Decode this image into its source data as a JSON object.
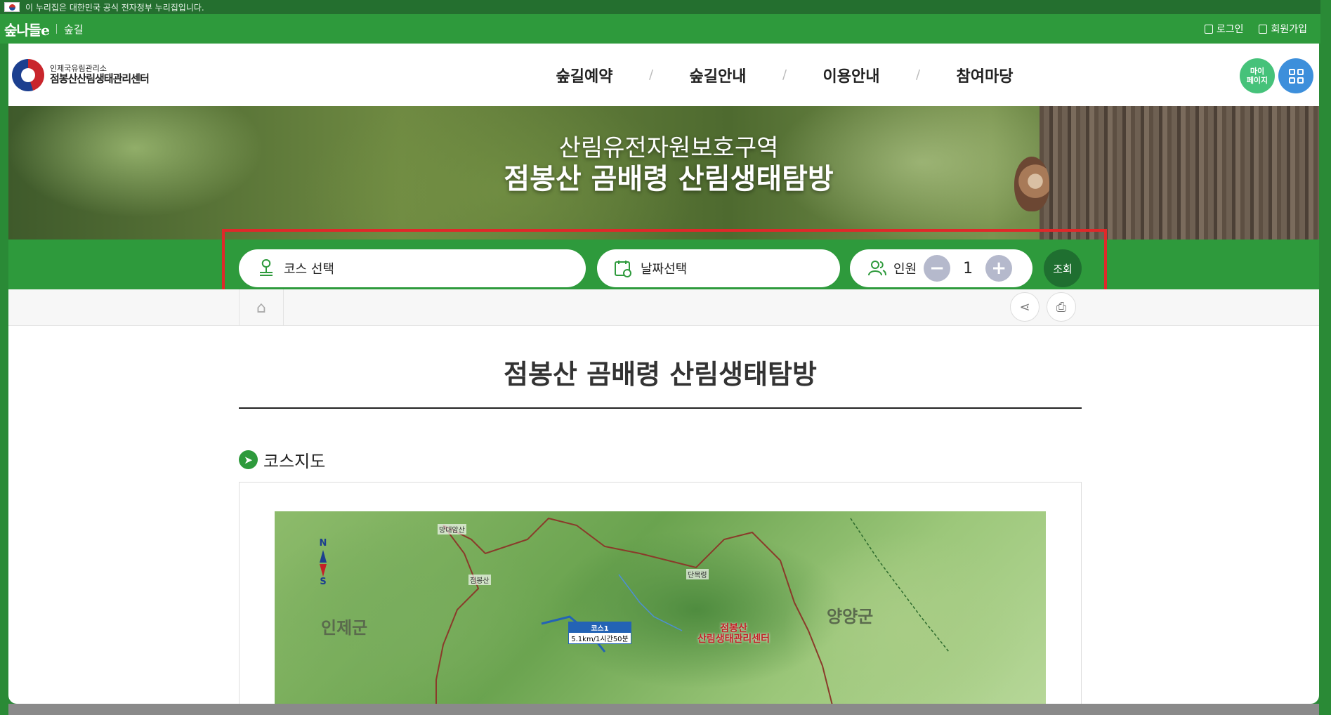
{
  "gov_banner": {
    "text": "이 누리집은 대한민국 공식 전자정부 누리집입니다."
  },
  "topbar": {
    "brand_logo": "숲나들e",
    "brand_sub": "숲길",
    "login": "로그인",
    "signup": "회원가입"
  },
  "header": {
    "org_small": "인제국유림관리소",
    "org_name": "점봉산산림생태관리센터",
    "nav": [
      "숲길예약",
      "숲길안내",
      "이용안내",
      "참여마당"
    ],
    "nav_separator": "/",
    "mypage": "마이\n페이지"
  },
  "hero": {
    "line1": "산림유전자원보호구역",
    "line2": "점봉산 곰배령 산림생태탐방"
  },
  "search": {
    "course_label": "코스 선택",
    "date_label": "날짜선택",
    "people_label": "인원",
    "count": "1",
    "minus": "−",
    "plus": "+",
    "submit": "조회"
  },
  "content": {
    "page_title": "점봉산 곰배령 산림생태탐방",
    "section_title": "코스지도"
  },
  "map": {
    "region_left": "인제군",
    "region_right": "양양군",
    "peak1": "망대암산",
    "peak2": "점봉산",
    "pass": "단목령",
    "compass_n": "N",
    "compass_s": "S",
    "course_name": "코스1",
    "course_info": "5.1km/1시간50분",
    "center_line1": "점봉산",
    "center_line2": "산림생태관리센터"
  },
  "colors": {
    "brand_green": "#2e9a3c",
    "highlight_red": "#e0282a",
    "dark_green": "#1f6f30",
    "mypage_green": "#46c27a",
    "menu_blue": "#3d8fdb"
  }
}
